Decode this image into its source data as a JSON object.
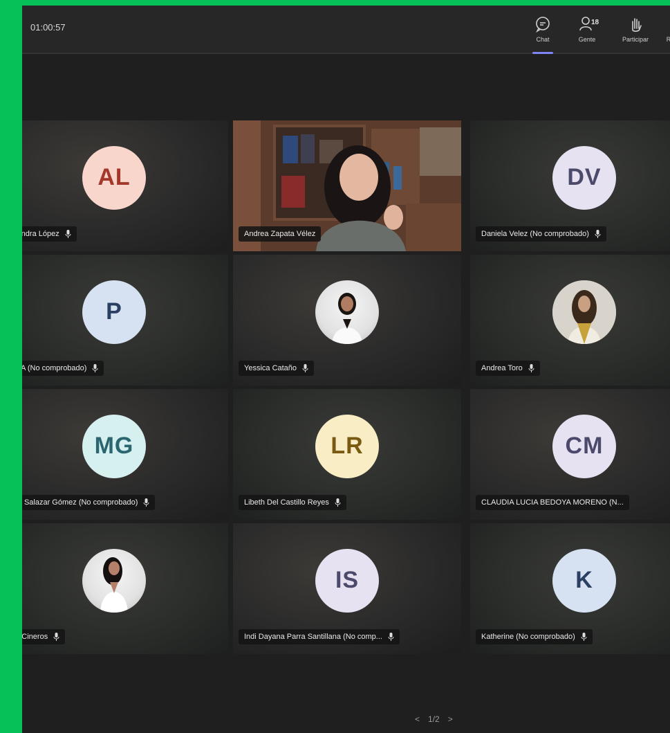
{
  "meeting": {
    "timer": "01:00:57"
  },
  "toolbar": {
    "chat_label": "Chat",
    "people_label": "Gente",
    "people_count": "18",
    "raise_label": "Participar",
    "more_label": "R"
  },
  "tiles": [
    {
      "name": "ejandra López",
      "initials": "AL",
      "avatar_bg": "#f8d6cc",
      "avatar_fg": "#a4372a",
      "type": "initials"
    },
    {
      "name": "Andrea Zapata Vélez",
      "type": "video"
    },
    {
      "name": "Daniela Velez (No comprobado)",
      "initials": "DV",
      "avatar_bg": "#e6e2f2",
      "avatar_fg": "#4b4a6b",
      "type": "initials"
    },
    {
      "name": "ULA (No comprobado)",
      "initials": "P",
      "avatar_bg": "#d6e2f2",
      "avatar_fg": "#2a3f62",
      "type": "initials"
    },
    {
      "name": "Yessica Cataño",
      "type": "photo"
    },
    {
      "name": "Andrea Toro",
      "type": "photo"
    },
    {
      "name": "reo Salazar Gómez (No comprobado)",
      "initials": "MG",
      "avatar_bg": "#d6efef",
      "avatar_fg": "#2a6570",
      "type": "initials"
    },
    {
      "name": "Libeth Del Castillo Reyes",
      "initials": "LR",
      "avatar_bg": "#f9edc6",
      "avatar_fg": "#7a5a10",
      "type": "initials"
    },
    {
      "name": "CLAUDIA LUCIA BEDOYA MORENO (N...",
      "initials": "CM",
      "avatar_bg": "#e6e2f2",
      "avatar_fg": "#4b4a6b",
      "type": "initials"
    },
    {
      "name": "an Cineros",
      "type": "photo"
    },
    {
      "name": "Indi Dayana Parra Santillana (No comp...",
      "initials": "IS",
      "avatar_bg": "#e6e2f2",
      "avatar_fg": "#4b4a6b",
      "type": "initials"
    },
    {
      "name": "Katherine (No comprobado)",
      "initials": "K",
      "avatar_bg": "#d6e2f2",
      "avatar_fg": "#2a3f62",
      "type": "initials"
    }
  ],
  "pager": {
    "prev": "<",
    "label": "1/2",
    "next": ">"
  }
}
